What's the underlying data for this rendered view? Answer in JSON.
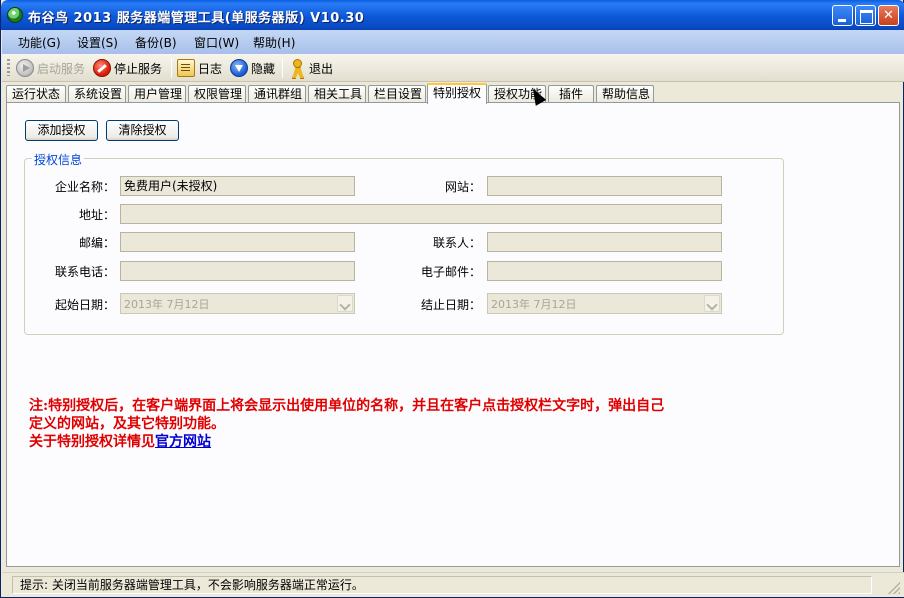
{
  "window": {
    "title": "布谷鸟 2013 服务器端管理工具(单服务器版) V10.30"
  },
  "menu": {
    "items": [
      "功能(G)",
      "设置(S)",
      "备份(B)",
      "窗口(W)",
      "帮助(H)"
    ]
  },
  "toolbar": {
    "start_label": "启动服务",
    "stop_label": "停止服务",
    "log_label": "日志",
    "hide_label": "隐藏",
    "exit_label": "退出"
  },
  "tabs": [
    "运行状态",
    "系统设置",
    "用户管理",
    "权限管理",
    "通讯群组",
    "相关工具",
    "栏目设置",
    "特别授权",
    "授权功能",
    "插件",
    "帮助信息"
  ],
  "active_tab": "特别授权",
  "buttons": {
    "add_auth": "添加授权",
    "clear_auth": "清除授权"
  },
  "auth_info": {
    "group_title": "授权信息",
    "company_label": "企业名称：",
    "company_value": "免费用户(未授权)",
    "website_label": "网站：",
    "website_value": "",
    "address_label": "地址：",
    "address_value": "",
    "postcode_label": "邮编：",
    "postcode_value": "",
    "contact_label": "联系人：",
    "contact_value": "",
    "phone_label": "联系电话：",
    "phone_value": "",
    "email_label": "电子邮件：",
    "email_value": "",
    "start_date_label": "起始日期：",
    "start_date_value": "2013年  7月12日",
    "end_date_label": "结止日期：",
    "end_date_value": "2013年  7月12日"
  },
  "note": {
    "line1": "注:特别授权后，在客户端界面上将会显示出使用单位的名称，并且在客户点击授权栏文字时，弹出自己",
    "line2": "定义的网站，及其它特别功能。",
    "line3_prefix": "关于特别授权详情见",
    "line3_link": "官方网站"
  },
  "status": {
    "text": "提示:  关闭当前服务器端管理工具，不会影响服务器端正常运行。"
  }
}
